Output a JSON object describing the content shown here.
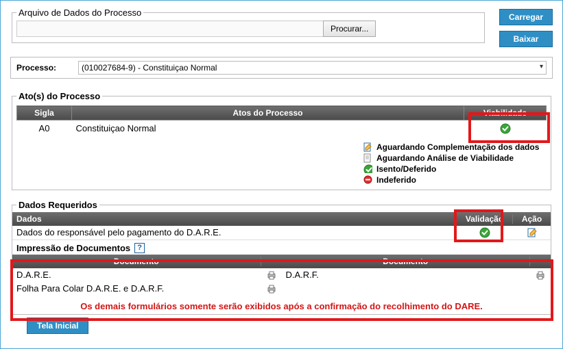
{
  "file_section": {
    "title": "Arquivo de Dados do Processo",
    "browse_label": "Procurar...",
    "input_value": ""
  },
  "buttons": {
    "load": "Carregar",
    "download": "Baixar",
    "home": "Tela Inicial"
  },
  "processo": {
    "label": "Processo:",
    "selected": "(010027684-9) - Constituiçao Normal"
  },
  "atos": {
    "section_title": "Ato(s) do Processo",
    "headers": {
      "sigla": "Sigla",
      "atos": "Atos do Processo",
      "viab": "Viabilidade"
    },
    "rows": [
      {
        "sigla": "A0",
        "ato": "Constituiçao Normal",
        "viab_status": "ok"
      }
    ],
    "legend": [
      {
        "icon": "doc-edit",
        "text": "Aguardando Complementação dos dados"
      },
      {
        "icon": "doc",
        "text": "Aguardando Análise de Viabilidade"
      },
      {
        "icon": "ok",
        "text": "Isento/Deferido"
      },
      {
        "icon": "stop",
        "text": "Indeferido"
      }
    ]
  },
  "dados": {
    "section_title": "Dados Requeridos",
    "headers": {
      "dados": "Dados",
      "valid": "Validação",
      "acao": "Ação"
    },
    "rows": [
      {
        "text": "Dados do responsável pelo pagamento do D.A.R.E.",
        "valid": "ok",
        "acao": "edit"
      }
    ]
  },
  "impressao": {
    "title": "Impressão de Documentos",
    "help": "?",
    "headers": {
      "doc": "Documento"
    },
    "rows": [
      {
        "left": "D.A.R.E.",
        "left_print": true,
        "right": "D.A.R.F.",
        "right_print": true
      },
      {
        "left": "Folha Para Colar D.A.R.E. e D.A.R.F.",
        "left_print": true,
        "right": "",
        "right_print": false
      }
    ],
    "warning": "Os demais formulários somente serão exibidos após a confirmação do recolhimento do DARE."
  }
}
